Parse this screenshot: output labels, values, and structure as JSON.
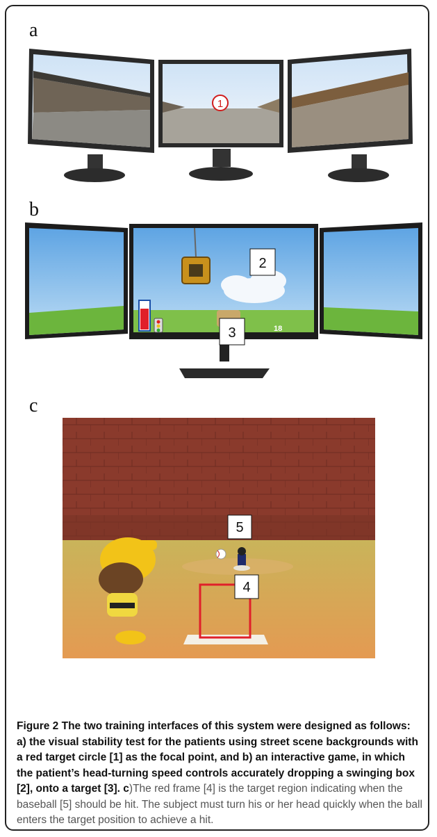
{
  "panels": {
    "a": {
      "label": "a",
      "target_marker": "1"
    },
    "b": {
      "label": "b",
      "box_label": "2",
      "target_label": "3",
      "hud_score": "18"
    },
    "c": {
      "label": "c",
      "frame_label": "4",
      "ball_label": "5"
    }
  },
  "caption": {
    "figure_label": "Figure 2",
    "bold_part": "The two training interfaces of this system were designed as follows: a) the visual stability test for the patients using street scene backgrounds with a red target circle [1] as the focal point, and b) an interactive game, in which the patient’s head-turning speed controls accurately dropping a swinging box [2], onto a target [3].",
    "c_label": "c",
    "rest": ")The red frame [4] is the target region indicating when the baseball [5] should be hit. The subject must turn his or her head quickly when the ball enters the target position to achieve a hit."
  },
  "colors": {
    "sky": "#7fb4e6",
    "grass": "#7fc04a",
    "brick": "#8a3a2c",
    "target_red": "#e0202a",
    "helmet": "#f2c318"
  },
  "icons": [
    "monitor-icon",
    "target-circle-icon",
    "crane-box-icon",
    "cloud-icon",
    "energy-bar-icon",
    "traffic-light-icon",
    "baseball-icon",
    "batter-icon",
    "pitcher-icon"
  ]
}
